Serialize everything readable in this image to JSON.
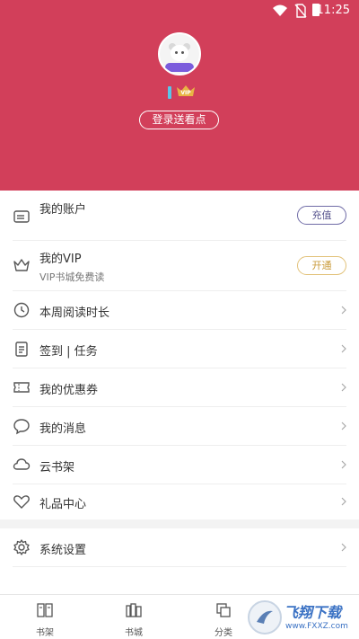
{
  "status_bar": {
    "time": "11:25"
  },
  "header": {
    "login_button": "登录送看点",
    "vip_badge": "VIP"
  },
  "menu": {
    "account": {
      "label": "我的账户",
      "action": "充值"
    },
    "vip": {
      "label": "我的VIP",
      "subtitle": "VIP书城免费读",
      "action": "开通"
    },
    "reading_time": {
      "label": "本周阅读时长"
    },
    "signin": {
      "label": "签到 | 任务"
    },
    "coupons": {
      "label": "我的优惠券"
    },
    "messages": {
      "label": "我的消息"
    },
    "cloud_shelf": {
      "label": "云书架"
    },
    "gift_center": {
      "label": "礼品中心"
    },
    "settings": {
      "label": "系统设置"
    }
  },
  "tab_bar": {
    "tabs": [
      {
        "label": "书架"
      },
      {
        "label": "书城"
      },
      {
        "label": "分类"
      }
    ]
  },
  "watermark": {
    "text": "飞翔下载",
    "url_text": "www.FXXZ.com"
  },
  "colors": {
    "header_bg": "#d23f5a",
    "vip_gold": "#e9b444",
    "recharge": "#6f6ba6"
  }
}
